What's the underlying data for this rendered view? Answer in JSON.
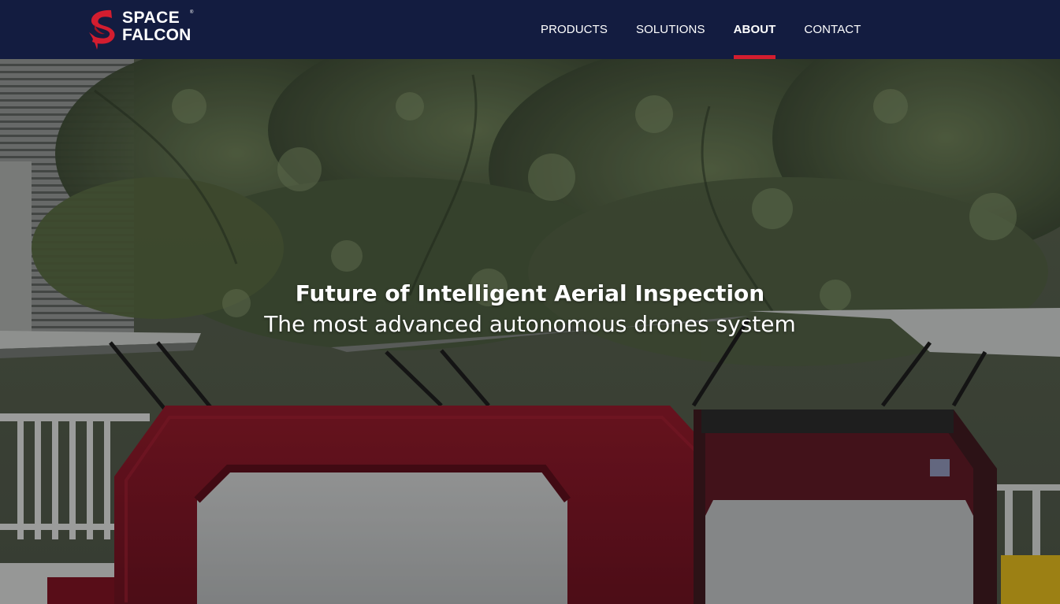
{
  "brand": {
    "name_line1": "SPACE",
    "name_line2": "FALCON",
    "trademark": "®",
    "logo_color": "#d31d2f"
  },
  "nav": {
    "background": "#131c40",
    "accent": "#d31d2f",
    "items": [
      {
        "label": "PRODUCTS",
        "active": false
      },
      {
        "label": "SOLUTIONS",
        "active": false
      },
      {
        "label": "ABOUT",
        "active": true
      },
      {
        "label": "CONTACT",
        "active": false
      }
    ]
  },
  "hero": {
    "title": "Future of Intelligent Aerial Inspection",
    "subtitle": "The most advanced autonomous drones system",
    "background_image": "drone-docking-station-photo"
  }
}
